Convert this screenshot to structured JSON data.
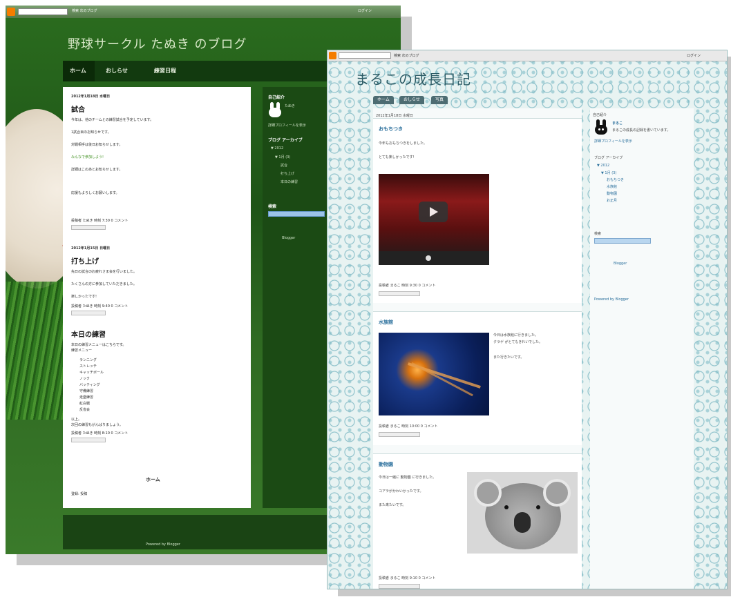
{
  "left_blog": {
    "navbar_text": "検索  次のブログ",
    "navbar_right": "ログイン",
    "title": "野球サークル たぬき のブログ",
    "tabs": [
      "ホーム",
      "おしらせ",
      "練習日程"
    ],
    "posts": [
      {
        "date": "2012年1月18日 水曜日",
        "heading": "試合",
        "lines": [
          "今年は、他のチームとの練習試合を予定しています。",
          "1試合目のお知らせです。",
          "対戦相手は後日お知らせします。",
          "みんなで参加しよう!",
          "",
          "詳細はこのあとお知らせします。",
          "応援もよろしくお願いします。"
        ],
        "meta": "投稿者 たぬき 時刻 7:30  0 コメント"
      },
      {
        "date": "2012年1月15日 日曜日",
        "heading": "打ち上げ",
        "lines": [
          "先日の試合のお疲れさま会を行いました。",
          "たくさんの方に参加していただきました。",
          "楽しかったです!"
        ],
        "meta": "投稿者 たぬき 時刻 9:40  0 コメント"
      },
      {
        "date": "",
        "heading": "本日の練習",
        "lines": [
          "本日の練習メニューはこちらです。",
          "練習メニュー"
        ],
        "list": [
          "ランニング",
          "ストレッチ",
          "キャッチボール",
          "ノック",
          "バッティング",
          "守備練習",
          "走塁練習",
          "紅白戦",
          "反省会"
        ],
        "after": [
          "以上。",
          "次回の練習もがんばりましょう。"
        ],
        "meta": "投稿者 たぬき 時刻 8:10  0 コメント"
      }
    ],
    "home_link": "ホーム",
    "subscribe": "登録: 投稿",
    "sidebar": {
      "profile_title": "自己紹介",
      "profile_name": "たぬき",
      "profile_link": "詳細プロフィールを表示",
      "archive_title": "ブログ アーカイブ",
      "archive_items": [
        "▼ 2012",
        "▼ 1月 (3)",
        "試合",
        "打ち上げ",
        "本日の練習"
      ],
      "search_title": "検索",
      "search_placeholder": "",
      "widget_text": "Blogger"
    },
    "footer": "Powered by Blogger"
  },
  "right_blog": {
    "navbar_text": "検索  次のブログ",
    "navbar_right": "ログイン",
    "title": "まるこの成長日記",
    "tabs": [
      "ホーム",
      "おしらせ",
      "写真"
    ],
    "posts": [
      {
        "date": "2012年1月18日 水曜日",
        "heading": "おもちつき",
        "lines": [
          "今年もおもちつきをしました。",
          "とても楽しかったです!"
        ],
        "meta": "投稿者 まるこ 時刻 9:30  0 コメント",
        "has_video": true
      },
      {
        "heading": "水族館",
        "lines": [
          "今日は水族館に行きました。",
          "クラゲ がとてもきれいでした。",
          "また行きたいです。"
        ],
        "meta": "投稿者 まるこ 時刻 10:00  0 コメント"
      },
      {
        "heading": "動物園",
        "lines": [
          "今日は一緒に 動物園 に行きました。",
          "コアラがかわいかったです。",
          "また来たいです。"
        ],
        "meta": "投稿者 まるこ 時刻 9:10  0 コメント"
      }
    ],
    "sidebar": {
      "profile_title": "自己紹介",
      "profile_name": "まるこ",
      "profile_desc": "まるこの成長の記録を書いています。",
      "profile_link": "詳細プロフィールを表示",
      "archive_title": "ブログ アーカイブ",
      "archive_items": [
        "▼ 2012",
        "▼ 1月 (3)",
        "おもちつき",
        "水族館",
        "動物園",
        "お正月"
      ],
      "search_title": "検索",
      "widget_text": "Blogger",
      "footer_link": "Powered by Blogger"
    }
  }
}
